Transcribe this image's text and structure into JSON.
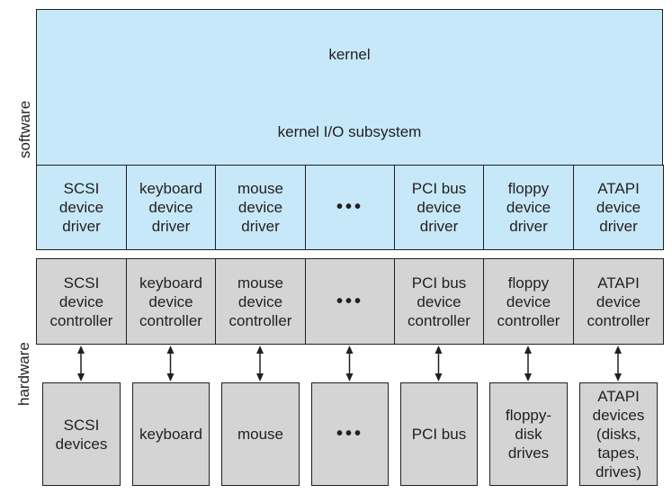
{
  "labels": {
    "software": "software",
    "hardware": "hardware"
  },
  "kernel": "kernel",
  "kernel_io": "kernel I/O subsystem",
  "drivers": [
    "SCSI\ndevice\ndriver",
    "keyboard\ndevice\ndriver",
    "mouse\ndevice\ndriver",
    "•••",
    "PCI bus\ndevice\ndriver",
    "floppy\ndevice\ndriver",
    "ATAPI\ndevice\ndriver"
  ],
  "controllers": [
    "SCSI\ndevice\ncontroller",
    "keyboard\ndevice\ncontroller",
    "mouse\ndevice\ncontroller",
    "•••",
    "PCI bus\ndevice\ncontroller",
    "floppy\ndevice\ncontroller",
    "ATAPI\ndevice\ncontroller"
  ],
  "devices": [
    "SCSI\ndevices",
    "keyboard",
    "mouse",
    "•••",
    "PCI bus",
    "floppy-\ndisk\ndrives",
    "ATAPI\ndevices\n(disks,\ntapes,\ndrives)"
  ],
  "colors": {
    "software": "#c6e8f8",
    "hardware": "#d4d4d4",
    "border": "#231f20"
  }
}
